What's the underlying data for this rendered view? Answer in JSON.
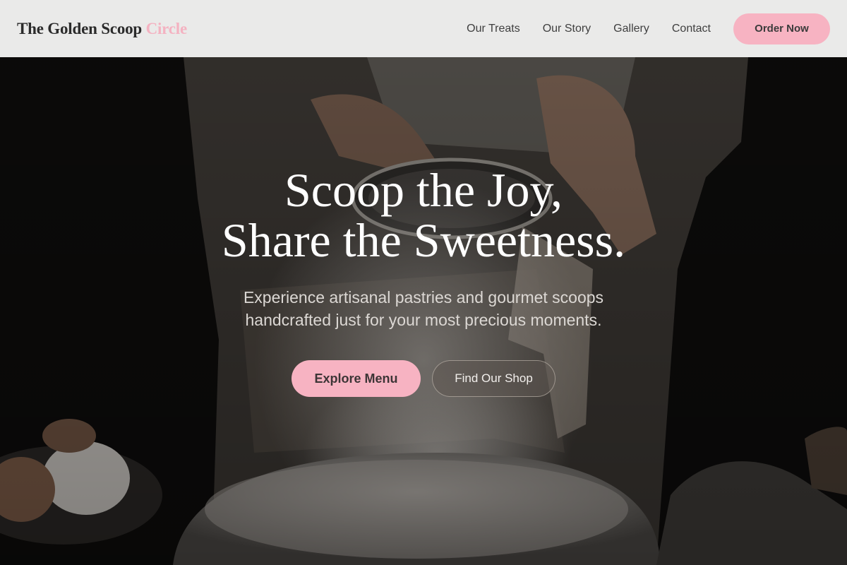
{
  "header": {
    "logo_main": "The Golden Scoop",
    "logo_accent": "Circle",
    "nav": [
      "Our Treats",
      "Our Story",
      "Gallery",
      "Contact"
    ],
    "cta_label": "Order Now"
  },
  "hero": {
    "title_line1": "Scoop the Joy,",
    "title_line2": "Share the Sweetness.",
    "subtitle_line1": "Experience artisanal pastries and gourmet scoops",
    "subtitle_line2": "handcrafted just for your most precious moments.",
    "primary_button": "Explore Menu",
    "secondary_button": "Find Our Shop"
  },
  "colors": {
    "accent_pink": "#f7b3c2",
    "header_bg": "#f2f2f1",
    "hero_text": "#ffffff"
  }
}
